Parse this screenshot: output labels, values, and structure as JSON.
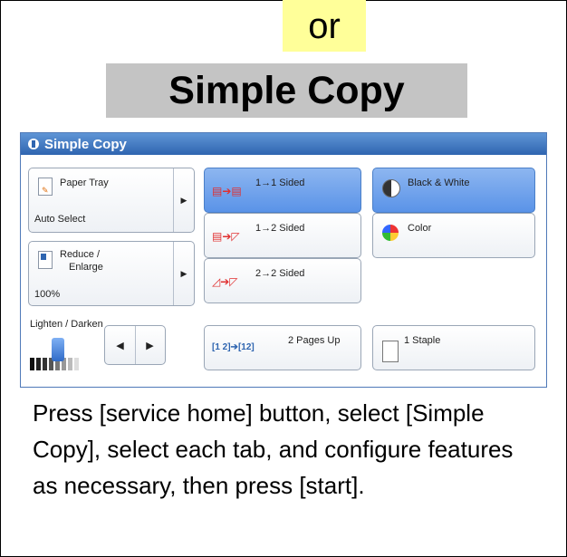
{
  "header": {
    "or_label": "or",
    "title": "Simple Copy"
  },
  "panel": {
    "title": "Simple Copy",
    "paper_tray": {
      "label": "Paper Tray",
      "value": "Auto Select"
    },
    "reduce_enlarge": {
      "label_line1": "Reduce /",
      "label_line2": "Enlarge",
      "value": "100%"
    },
    "sides": [
      {
        "label": "1→1 Sided",
        "selected": true
      },
      {
        "label": "1→2 Sided",
        "selected": false
      },
      {
        "label": "2→2 Sided",
        "selected": false
      }
    ],
    "color_mode": [
      {
        "label": "Black & White",
        "selected": true
      },
      {
        "label": "Color",
        "selected": false
      }
    ],
    "lighten_darken": {
      "label": "Lighten / Darken"
    },
    "pages_up": {
      "label": "2 Pages Up"
    },
    "staple": {
      "label": "1 Staple"
    }
  },
  "caption": "Press [service home] button, select [Simple Copy], select each tab, and configure features as necessary, then press [start].",
  "colors": {
    "highlight_yellow": "#ffff99",
    "title_gray": "#c4c4c4",
    "titlebar_blue": "#2f65b0",
    "selected_blue": "#5a93e8"
  }
}
